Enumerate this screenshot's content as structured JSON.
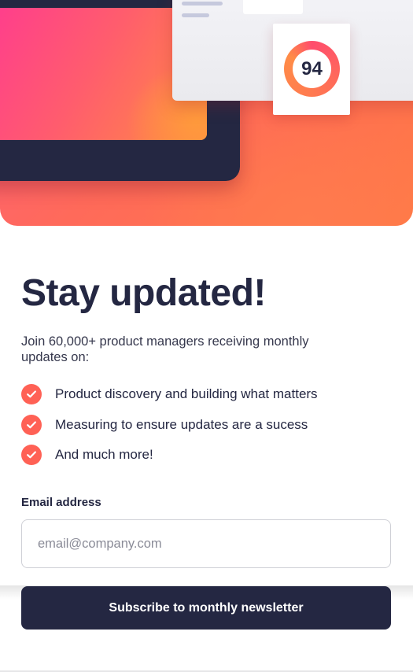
{
  "hero": {
    "score": "94",
    "colors": {
      "primary": "#ff6155",
      "dark": "#242742",
      "gradient_start": "#ff3f8b",
      "gradient_end": "#ff8c43"
    }
  },
  "signup": {
    "title": "Stay updated!",
    "intro": "Join 60,000+ product managers receiving monthly updates on:",
    "features": [
      {
        "label": "Product discovery and building what matters",
        "icon": "check-icon"
      },
      {
        "label": "Measuring to ensure updates are a sucess",
        "icon": "check-icon"
      },
      {
        "label": "And much more!",
        "icon": "check-icon"
      }
    ],
    "email": {
      "label": "Email address",
      "value": "",
      "placeholder": "email@company.com"
    },
    "submit_label": "Subscribe to monthly newsletter"
  }
}
